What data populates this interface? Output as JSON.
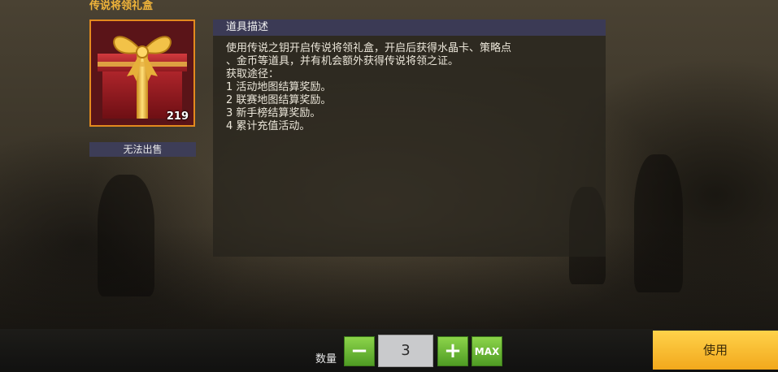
{
  "item": {
    "name": "传说将领礼盒",
    "count": "219",
    "sell_status": "无法出售",
    "icon": "red-gift-box-icon"
  },
  "description": {
    "header": "道具描述",
    "lines": [
      "使用传说之钥开启传说将领礼盒，开启后获得水晶卡、策略点",
      "、金币等道具，并有机会额外获得传说将领之证。",
      "获取途径：",
      "1 活动地图结算奖励。",
      "2 联赛地图结算奖励。",
      "3 新手榜结算奖励。",
      "4 累计充值活动。"
    ]
  },
  "quantity": {
    "label": "数量",
    "value": "3",
    "minus_label": "−",
    "plus_label": "+",
    "max_label": "MAX"
  },
  "use_button": {
    "label": "使用"
  },
  "colors": {
    "title": "#f0b43a",
    "frame_border": "#e38a1e",
    "header_bg": "#3b3a55",
    "green_button": "#6cbf38",
    "use_button": "#f7b52a"
  }
}
